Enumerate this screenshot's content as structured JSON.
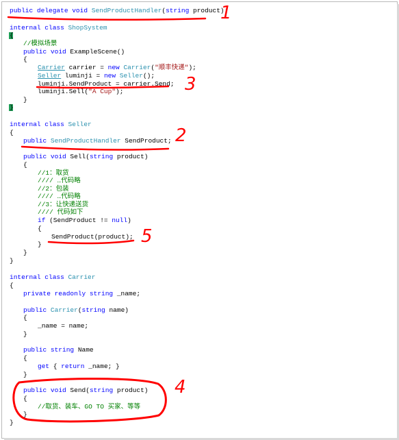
{
  "code": {
    "l1": {
      "kw1": "public",
      "kw2": "delegate",
      "kw3": "void",
      "type": "SendProductHandler",
      "open": "(",
      "kw4": "string",
      "rest": " product);"
    },
    "l2": {
      "kw": "internal class",
      "type": "ShopSystem"
    },
    "l3": {
      "text": "{"
    },
    "l4": {
      "comment": "//模拟场景"
    },
    "l5": {
      "kw1": "public",
      "kw2": "void",
      "rest": " ExampleScene()"
    },
    "l6": {
      "text": "{"
    },
    "l7": {
      "type1": "Carrier",
      "mid": " carrier = ",
      "kw": "new",
      "type2": "Carrier",
      "open": "(",
      "str": "\"顺丰快递\"",
      "close": ");"
    },
    "l8": {
      "type1": "Seller",
      "mid": " luminji = ",
      "kw": "new",
      "type2": "Seller",
      "close": "();"
    },
    "l9": {
      "text": "luminji.SendProduct = carrier.Send;"
    },
    "l10": {
      "pre": "luminji.Sell(",
      "str": "\"A Cup\"",
      "close": ");"
    },
    "l11": {
      "text": "}"
    },
    "l12": {
      "text": "}"
    },
    "l13": {
      "kw": "internal class",
      "type": "Seller"
    },
    "l14": {
      "text": "{"
    },
    "l15": {
      "kw": "public",
      "type": "SendProductHandler",
      "rest": " SendProduct;"
    },
    "l16": {
      "kw1": "public",
      "kw2": "void",
      "mid": " Sell(",
      "kw3": "string",
      "rest": " product)"
    },
    "l17": {
      "text": "{"
    },
    "l18": {
      "comment": "//1：取货"
    },
    "l19": {
      "comment": "//// …代码略"
    },
    "l20": {
      "comment": "//2：包装"
    },
    "l21": {
      "comment": "//// …代码略"
    },
    "l22": {
      "comment": "//3：让快递送货"
    },
    "l23": {
      "comment": "//// 代码如下"
    },
    "l24": {
      "kw": "if",
      "mid": " (SendProduct != ",
      "kw2": "null",
      "close": ")"
    },
    "l25": {
      "text": "{"
    },
    "l26": {
      "text": "SendProduct(product);"
    },
    "l27": {
      "text": "}"
    },
    "l28": {
      "text": "}"
    },
    "l29": {
      "text": "}"
    },
    "l30": {
      "kw": "internal class",
      "type": "Carrier"
    },
    "l31": {
      "text": "{"
    },
    "l32": {
      "kw": "private readonly string",
      "rest": " _name;"
    },
    "l33": {
      "kw": "public",
      "type": "Carrier",
      "open": "(",
      "kw2": "string",
      "rest": " name)"
    },
    "l34": {
      "text": "{"
    },
    "l35": {
      "text": "_name = name;"
    },
    "l36": {
      "text": "}"
    },
    "l37": {
      "kw": "public string",
      "rest": " Name"
    },
    "l38": {
      "text": "{"
    },
    "l39": {
      "kw1": "get",
      "mid": " { ",
      "kw2": "return",
      "rest": " _name; }"
    },
    "l40": {
      "text": "}"
    },
    "l41": {
      "kw1": "public",
      "kw2": "void",
      "mid": " Send(",
      "kw3": "string",
      "rest": " product)"
    },
    "l42": {
      "text": "{"
    },
    "l43": {
      "comment": "//取货、装车、GO TO 买家、等等"
    },
    "l44": {
      "text": "}"
    },
    "l45": {
      "text": "}"
    }
  },
  "annotations": {
    "n1": "1",
    "n2": "2",
    "n3": "3",
    "n4": "4",
    "n5": "5",
    "ink_color": "#ff0000"
  },
  "colors": {
    "keyword": "#0000ff",
    "type": "#2b91af",
    "string": "#a31515",
    "comment": "#008000"
  }
}
